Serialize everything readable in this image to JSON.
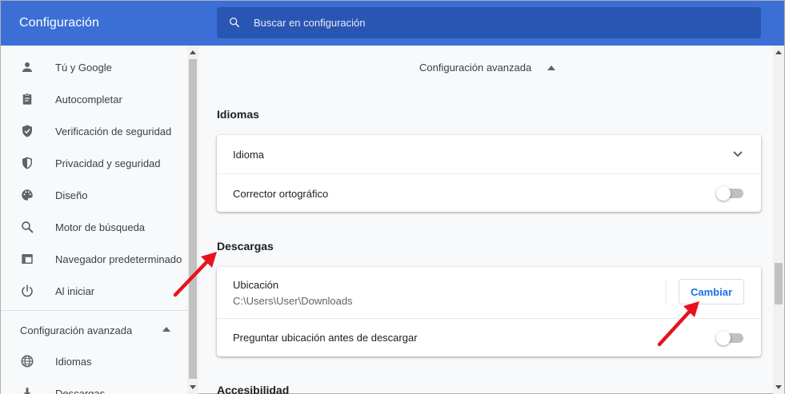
{
  "header": {
    "title": "Configuración",
    "search_placeholder": "Buscar en configuración"
  },
  "sidebar": {
    "items": [
      {
        "label": "Tú y Google",
        "icon": "person-icon"
      },
      {
        "label": "Autocompletar",
        "icon": "clipboard-icon"
      },
      {
        "label": "Verificación de seguridad",
        "icon": "shield-check-icon"
      },
      {
        "label": "Privacidad y seguridad",
        "icon": "shield-icon"
      },
      {
        "label": "Diseño",
        "icon": "palette-icon"
      },
      {
        "label": "Motor de búsqueda",
        "icon": "search-icon"
      },
      {
        "label": "Navegador predeterminado",
        "icon": "browser-icon"
      },
      {
        "label": "Al iniciar",
        "icon": "power-icon"
      }
    ],
    "advanced_label": "Configuración avanzada",
    "advanced_items": [
      {
        "label": "Idiomas",
        "icon": "globe-icon"
      },
      {
        "label": "Descargas",
        "icon": "download-icon"
      }
    ]
  },
  "main": {
    "advanced_heading": "Configuración avanzada",
    "languages": {
      "title": "Idiomas",
      "language_label": "Idioma",
      "spellcheck_label": "Corrector ortográfico",
      "spellcheck_enabled": false
    },
    "downloads": {
      "title": "Descargas",
      "location_label": "Ubicación",
      "location_path": "C:\\Users\\User\\Downloads",
      "change_button": "Cambiar",
      "ask_label": "Preguntar ubicación antes de descargar",
      "ask_enabled": false
    },
    "accessibility": {
      "title": "Accesibilidad"
    }
  },
  "colors": {
    "header_bg": "#3c6fd6",
    "search_bg": "#2a56b3",
    "accent": "#1a73e8",
    "annotation_arrow": "#e8121f"
  }
}
